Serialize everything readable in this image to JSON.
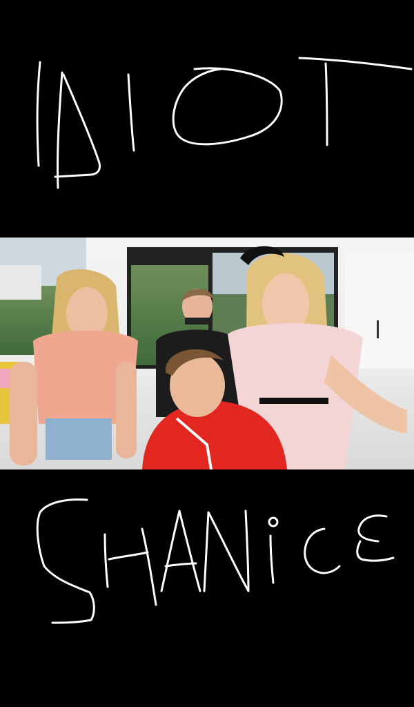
{
  "top_caption": {
    "text": "IDIOT"
  },
  "bottom_caption": {
    "text": "SHANiCE"
  },
  "colors": {
    "background": "#000000",
    "stroke": "#ffffff"
  }
}
